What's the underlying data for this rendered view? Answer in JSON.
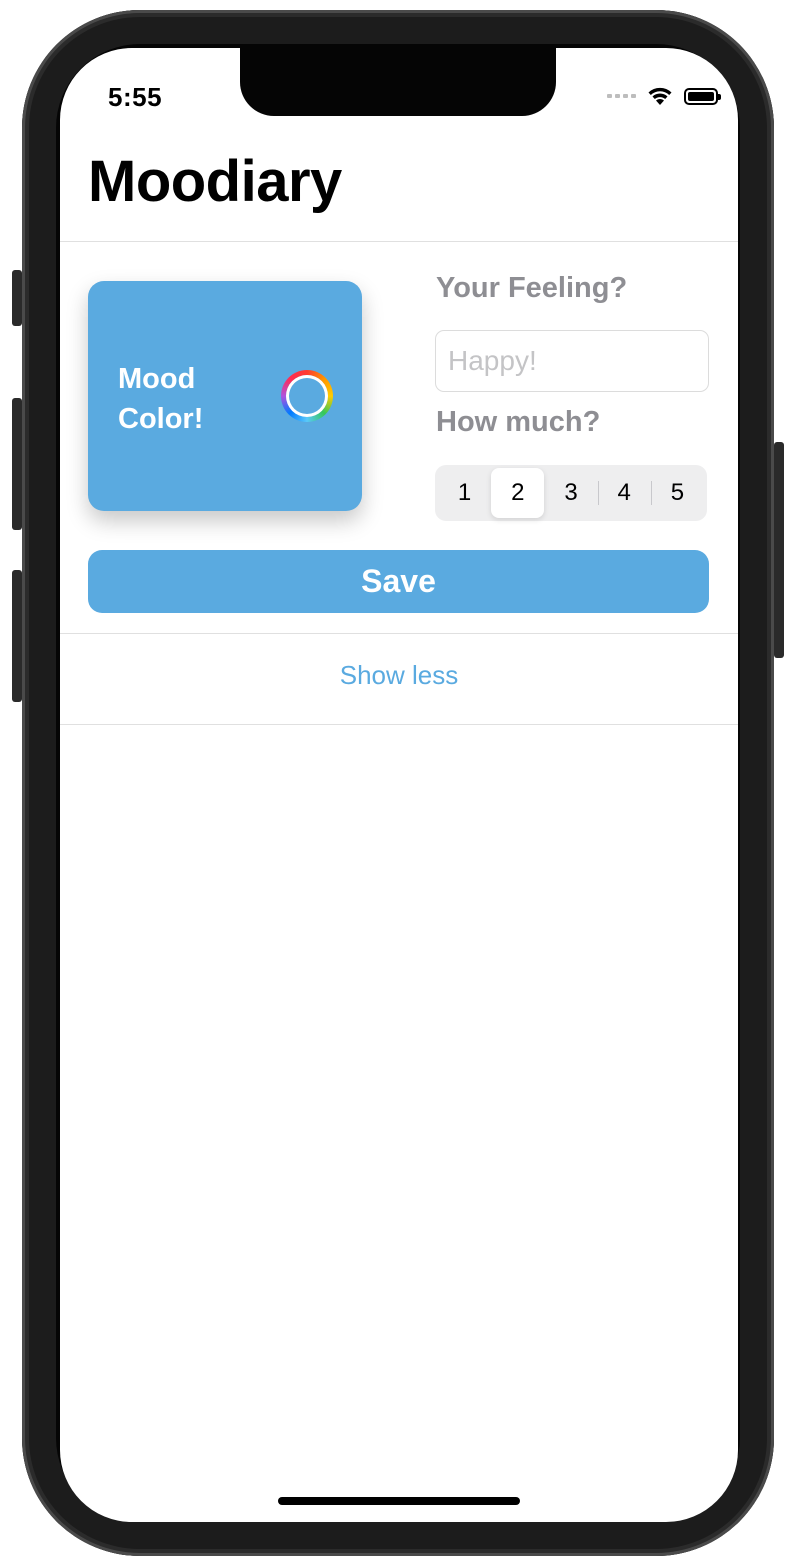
{
  "status_bar": {
    "time": "5:55",
    "wifi_icon": "wifi-icon",
    "battery_icon": "battery-icon"
  },
  "navigation": {
    "title": "Moodiary"
  },
  "mood_card": {
    "label": "Mood Color!",
    "color": "#5aaae0",
    "picker_icon": "color-wheel-icon"
  },
  "feeling": {
    "label": "Your Feeling?",
    "placeholder": "Happy!",
    "value": ""
  },
  "intensity": {
    "label": "How much?",
    "options": [
      "1",
      "2",
      "3",
      "4",
      "5"
    ],
    "selected": "2"
  },
  "actions": {
    "save_label": "Save",
    "show_less_label": "Show less"
  },
  "colors": {
    "accent": "#5aaae0",
    "secondary_text": "#8e8e93"
  }
}
